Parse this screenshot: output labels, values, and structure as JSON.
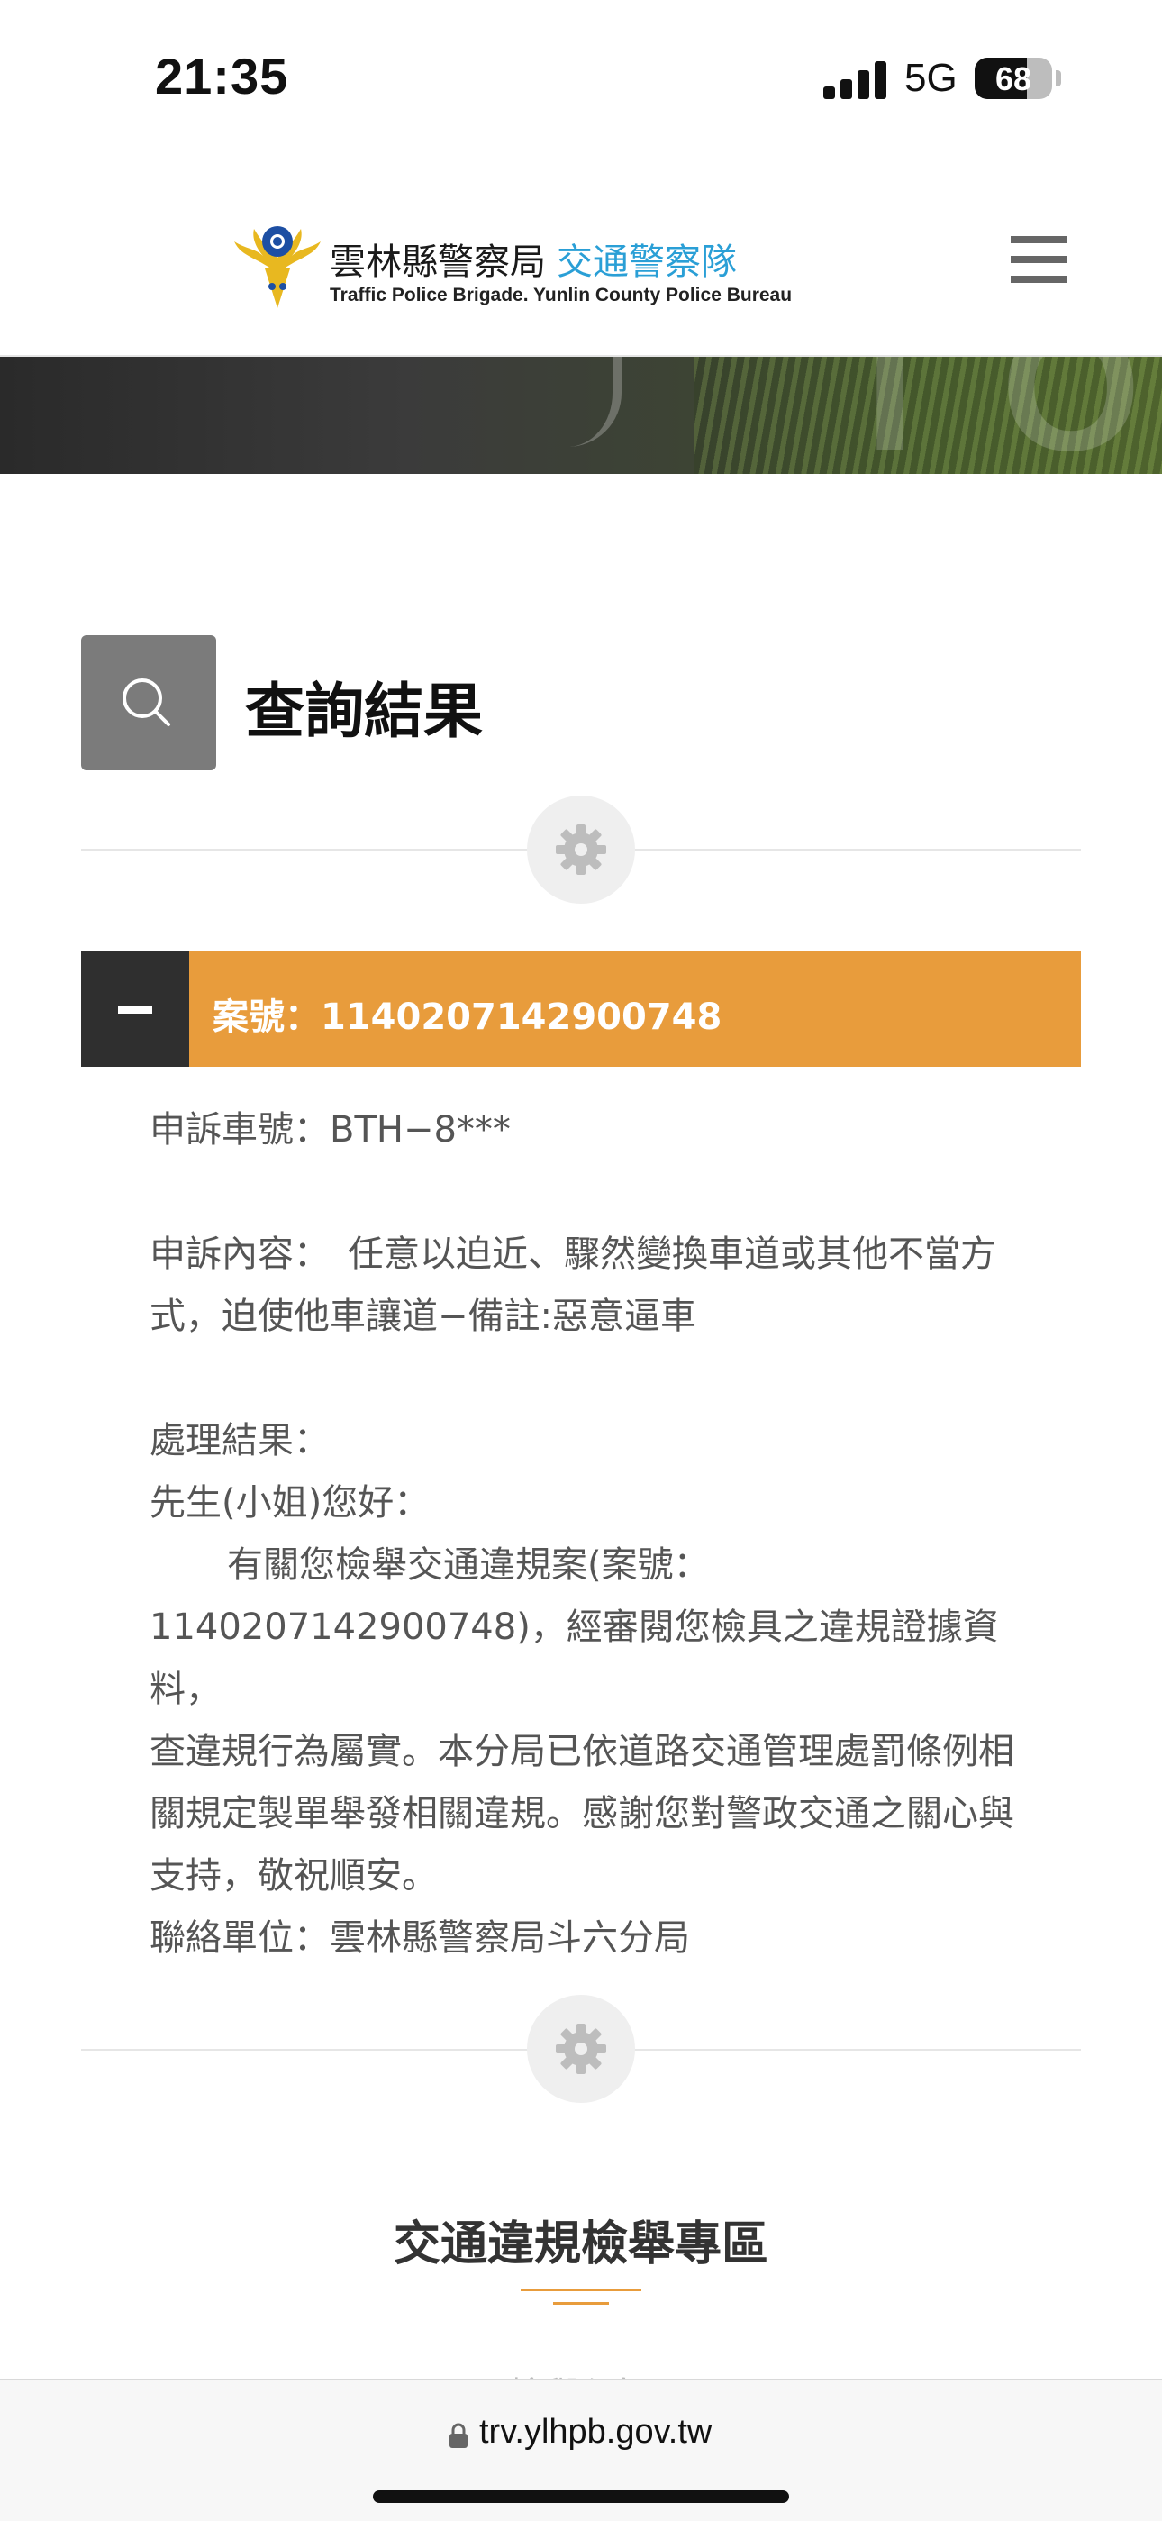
{
  "status_bar": {
    "time": "21:35",
    "network": "5G",
    "battery_percent": "68",
    "battery_level": 0.68
  },
  "header": {
    "emblem_icon": "police-emblem-icon",
    "title_zh": "雲林縣警察局",
    "title_zh_accent": "交通警察隊",
    "title_en": "Traffic Police Brigade. Yunlin County Police Bureau",
    "menu_icon": "hamburger-menu-icon"
  },
  "page": {
    "search_icon": "search-icon",
    "title": "查詢結果",
    "divider_icon": "gear-icon"
  },
  "case": {
    "toggle_icon": "minus-icon",
    "label": "案號：1140207142900748",
    "plate": "申訴車號：BTH−8***",
    "content_line1": "申訴內容：　任意以迫近、驟然變換車道或其他不當方",
    "content_line2": "式，迫使他車讓道−備註:惡意逼車",
    "result_heading": "處理結果：",
    "greeting": "先生(小姐)您好：",
    "result_line1": "有關您檢舉交通違規案(案號：",
    "result_line2": "1140207142900748)，經審閱您檢具之違規證據資料，",
    "result_line3": "查違規行為屬實。本分局已依道路交通管理處罰條例相",
    "result_line4": "關規定製單舉發相關違規。感謝您對警政交通之關心與",
    "result_line5": "支持，敬祝順安。",
    "contact": "聯絡單位：雲林縣警察局斗六分局"
  },
  "section": {
    "title": "交通違規檢舉專區",
    "next_text": "檢舉須知"
  },
  "browser": {
    "lock_icon": "lock-icon",
    "url": "trv.ylhpb.gov.tw"
  },
  "colors": {
    "accent_orange": "#e89c3c",
    "accent_blue": "#2a9fd6",
    "dark": "#2f2f2f",
    "search_box": "#7b7b7b"
  }
}
